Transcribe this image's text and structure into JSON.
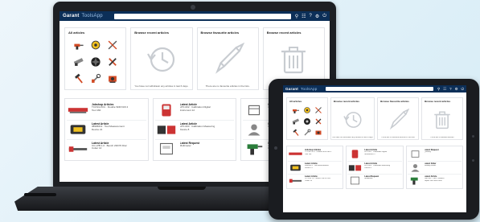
{
  "app": {
    "logo": "Garant",
    "logo_sub": "ToolsApp",
    "header_icons": [
      "search-icon",
      "cart-icon",
      "help-icon",
      "settings-icon",
      "power-icon"
    ],
    "accent": "#0c2f58"
  },
  "tiles": {
    "categories": {
      "title": "All articles",
      "icons": [
        "drill-icon",
        "measuring-icon",
        "cutter-icon",
        "saw-icon",
        "disc-icon",
        "pliers-icon",
        "hammer-icon",
        "wrench-icon",
        "machine-icon"
      ]
    },
    "recent": {
      "title": "Browse recent articles",
      "foot": "You have not withdrawn any articles in last 6 days.",
      "icon": "history-icon"
    },
    "favorites": {
      "title": "Browse favourite articles",
      "foot": "There are no favourite articles in the lists.",
      "icon": "pen-icon"
    },
    "deleted": {
      "title": "Browse recent articles",
      "foot": "There are no deleted articles.",
      "icon": "trash-icon"
    }
  },
  "lists": [
    {
      "items": [
        {
          "title": "Jobshop Articles",
          "lines": [
            "TCCS/LOCU · Double SDR Drill 4",
            "Tool 160"
          ],
          "thumb": "drill-set"
        },
        {
          "title": "Latest Article",
          "lines": [
            "38906013 · Tool Measurement",
            "Device 21"
          ],
          "thumb": "tape-measure"
        },
        {
          "title": "Latest Article",
          "lines": [
            "CC-LPB 1.0 · Bench 230/70 Disc",
            "Cutter 14"
          ],
          "thumb": "cutter"
        }
      ]
    },
    {
      "items": [
        {
          "title": "Latest Article",
          "lines": [
            "HTF-002 · Calibration Digital",
            "Instrument 12"
          ],
          "thumb": "meter-red"
        },
        {
          "title": "Latest Article",
          "lines": [
            "HTF-003 · Calibration Measuring",
            "Device 8"
          ],
          "thumb": "meter-dark"
        },
        {
          "title": "Latest Request",
          "lines": [
            "Multimeter",
            ""
          ],
          "thumb": "multimeter"
        }
      ]
    },
    {
      "items": [
        {
          "title": "Latest Request",
          "lines": [
            "Quantity",
            ""
          ],
          "thumb": "box"
        },
        {
          "title": "Latest Order",
          "lines": [
            "Monday Status",
            ""
          ],
          "thumb": "person"
        },
        {
          "title": "Latest Article",
          "lines": [
            "ZHF-405 · 230V Cordless",
            "Impact Drill 3000-1800"
          ],
          "thumb": "drill-green"
        }
      ]
    }
  ]
}
